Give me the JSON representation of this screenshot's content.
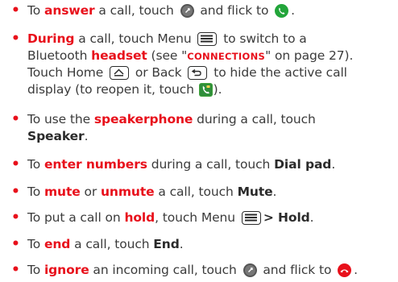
{
  "bullets": [
    {
      "pre": "To ",
      "kw": "answer",
      "mid": " a call, touch ",
      "mid2": " and flick to ",
      "end": "."
    },
    {
      "kw": "During",
      "t1": " a call, touch Menu ",
      "t2": " to switch to a",
      "t3": "Bluetooth ",
      "kw2": "headset",
      "t4": " (see \"",
      "ref": "CONNECTIONS",
      "t5": "\" on page 27).",
      "t6": "Touch Home ",
      "t7": " or Back ",
      "t8": " to hide the active call",
      "t9": "display (to reopen it, touch ",
      "t10": ")."
    },
    {
      "pre": "To use the ",
      "kw": "speakerphone",
      "mid": " during a call, touch",
      "bold": "Speaker",
      "end": "."
    },
    {
      "pre": "To ",
      "kw": "enter numbers",
      "mid": " during a call, touch ",
      "bold": "Dial pad",
      "end": "."
    },
    {
      "pre": "To ",
      "kw": "mute",
      "or": " or ",
      "kw2": "unmute",
      "mid": " a call, touch ",
      "bold": "Mute",
      "end": "."
    },
    {
      "pre": "To put a call on ",
      "kw": "hold",
      "mid": ", touch Menu ",
      "bold": "> Hold",
      "end": "."
    },
    {
      "pre": "To ",
      "kw": "end",
      "mid": " a call, touch ",
      "bold": "End",
      "end": "."
    },
    {
      "pre": "To ",
      "kw": "ignore",
      "mid": " an incoming call, touch ",
      "mid2": " and flick to ",
      "end": "."
    }
  ],
  "bullet_char": "•",
  "icons": {
    "answer_green": "answer-green-icon",
    "ignore_red": "ignore-red-icon",
    "handle": "slider-handle-icon",
    "menu": "menu-key-icon",
    "home": "home-key-icon",
    "back": "back-key-icon",
    "call": "active-call-icon"
  },
  "colors": {
    "accent": "#e8101b",
    "green": "#22a53a",
    "text": "#3b3b3b"
  }
}
